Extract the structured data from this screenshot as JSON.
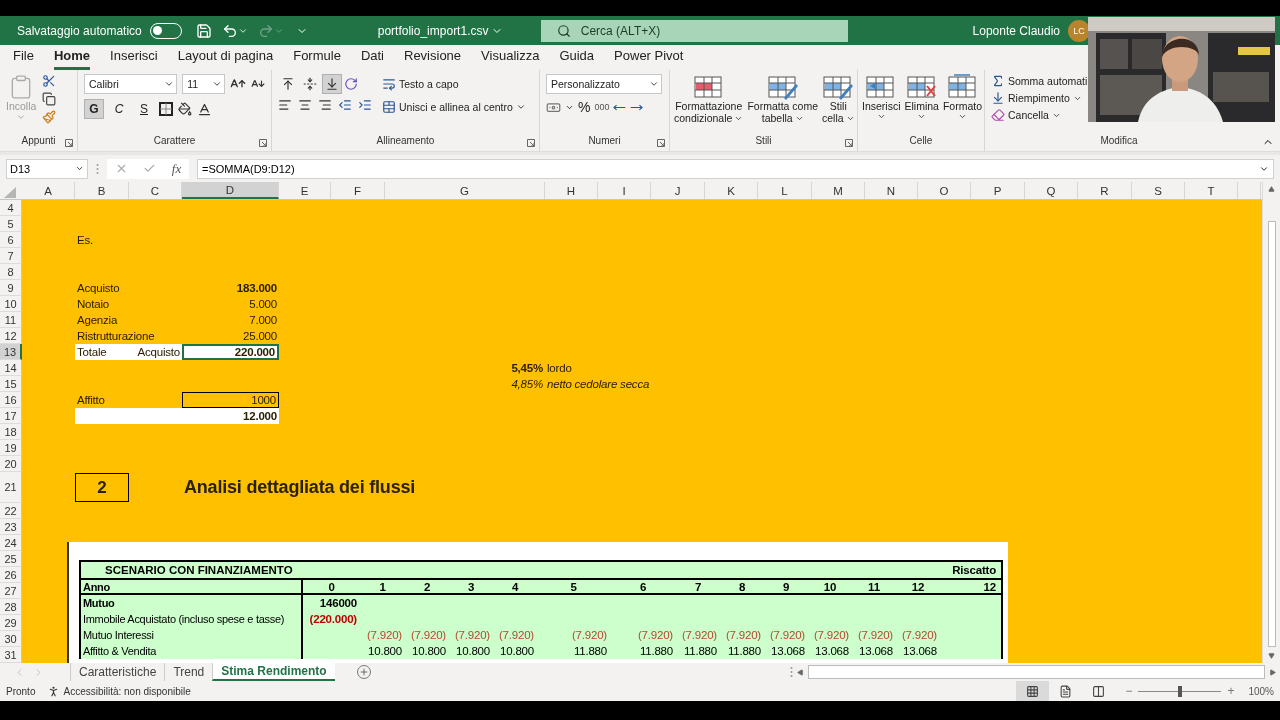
{
  "title_bar": {
    "autosave_label": "Salvataggio automatico",
    "autosave_on": false,
    "file_name": "portfolio_import1.csv",
    "search_placeholder": "Cerca (ALT+X)",
    "user_name": "Loponte Claudio",
    "user_initials": "LC"
  },
  "menu_tabs": [
    {
      "label": "File",
      "selected": false
    },
    {
      "label": "Home",
      "selected": true
    },
    {
      "label": "Inserisci",
      "selected": false
    },
    {
      "label": "Layout di pagina",
      "selected": false
    },
    {
      "label": "Formule",
      "selected": false
    },
    {
      "label": "Dati",
      "selected": false
    },
    {
      "label": "Revisione",
      "selected": false
    },
    {
      "label": "Visualizza",
      "selected": false
    },
    {
      "label": "Guida",
      "selected": false
    },
    {
      "label": "Power Pivot",
      "selected": false
    }
  ],
  "ribbon": {
    "appunti": {
      "paste": "Incolla",
      "group": "Appunti"
    },
    "carattere": {
      "font": "Calibri",
      "size": "11",
      "group": "Carattere",
      "toggles": [
        {
          "label": "G",
          "kind": "bold",
          "on": true
        },
        {
          "label": "C",
          "kind": "italic",
          "on": false
        },
        {
          "label": "S",
          "kind": "underline",
          "on": false
        }
      ]
    },
    "allineamento": {
      "vertical": [
        {
          "kind": "top",
          "on": false
        },
        {
          "kind": "middle",
          "on": false
        },
        {
          "kind": "bottom",
          "on": true
        }
      ],
      "wrap": "Testo a capo",
      "merge": "Unisci e allinea al centro",
      "group": "Allineamento"
    },
    "numeri": {
      "format": "Personalizzato",
      "percent": "%",
      "thousands": "000",
      "group": "Numeri"
    },
    "stili": {
      "buttons": [
        {
          "lines": [
            "Formattazione",
            "condizionale"
          ]
        },
        {
          "lines": [
            "Formatta come",
            "tabella"
          ]
        },
        {
          "lines": [
            "Stili",
            "cella"
          ]
        }
      ],
      "group": "Stili"
    },
    "celle": {
      "buttons": [
        "Inserisci",
        "Elimina",
        "Formato"
      ],
      "group": "Celle"
    },
    "modifica": {
      "items": [
        "Somma automati",
        "Riempimento",
        "Cancella"
      ],
      "group": "Modifica"
    }
  },
  "formula_bar": {
    "name_box": "D13",
    "fx": "fx",
    "formula": "=SOMMA(D9:D12)"
  },
  "columns": [
    {
      "label": "A",
      "selected": false
    },
    {
      "label": "B",
      "selected": false
    },
    {
      "label": "C",
      "selected": false
    },
    {
      "label": "D",
      "selected": true
    },
    {
      "label": "E",
      "selected": false
    },
    {
      "label": "F",
      "selected": false
    },
    {
      "label": "G",
      "selected": false
    },
    {
      "label": "H",
      "selected": false
    },
    {
      "label": "I",
      "selected": false
    },
    {
      "label": "J",
      "selected": false
    },
    {
      "label": "K",
      "selected": false
    },
    {
      "label": "L",
      "selected": false
    },
    {
      "label": "M",
      "selected": false
    },
    {
      "label": "N",
      "selected": false
    },
    {
      "label": "O",
      "selected": false
    },
    {
      "label": "P",
      "selected": false
    },
    {
      "label": "Q",
      "selected": false
    },
    {
      "label": "R",
      "selected": false
    },
    {
      "label": "S",
      "selected": false
    },
    {
      "label": "T",
      "selected": false
    }
  ],
  "rows": [
    {
      "number": "4",
      "selected": false
    },
    {
      "number": "5",
      "selected": false
    },
    {
      "number": "6",
      "selected": false,
      "cells": [
        {
          "kind": "note",
          "text": "Es."
        }
      ]
    },
    {
      "number": "7",
      "selected": false
    },
    {
      "number": "8",
      "selected": false
    },
    {
      "number": "9",
      "selected": false,
      "cells": [
        {
          "kind": "label",
          "text": "Acquisto"
        },
        {
          "kind": "amount-strong",
          "text": "183.000"
        }
      ]
    },
    {
      "number": "10",
      "selected": false,
      "cells": [
        {
          "kind": "label",
          "text": "Notaio"
        },
        {
          "kind": "amount",
          "text": "5.000"
        }
      ]
    },
    {
      "number": "11",
      "selected": false,
      "cells": [
        {
          "kind": "label",
          "text": "Agenzia"
        },
        {
          "kind": "amount",
          "text": "7.000"
        }
      ]
    },
    {
      "number": "12",
      "selected": false,
      "cells": [
        {
          "kind": "label",
          "text": "Ristrutturazione"
        },
        {
          "kind": "amount",
          "text": "25.000"
        }
      ]
    },
    {
      "number": "13",
      "selected": true,
      "cells": [
        {
          "kind": "total-label",
          "text": "Totale"
        },
        {
          "kind": "total-sub",
          "text": "Acquisto"
        },
        {
          "kind": "total-amount",
          "text": "220.000"
        }
      ]
    },
    {
      "number": "14",
      "selected": false,
      "cells": [
        {
          "kind": "rate-strong",
          "text": "5,45%"
        },
        {
          "kind": "rate-note",
          "text": "lordo"
        }
      ]
    },
    {
      "number": "15",
      "selected": false,
      "cells": [
        {
          "kind": "rate-italic",
          "text": "4,85%"
        },
        {
          "kind": "rate-note-italic",
          "text": "netto cedolare secca"
        }
      ]
    },
    {
      "number": "16",
      "selected": false,
      "cells": [
        {
          "kind": "label",
          "text": "Affitto"
        },
        {
          "kind": "input-amount",
          "text": "1000"
        }
      ]
    },
    {
      "number": "17",
      "selected": false,
      "cells": [
        {
          "kind": "blank-white"
        },
        {
          "kind": "total-amount",
          "text": "12.000"
        }
      ]
    },
    {
      "number": "18",
      "selected": false
    },
    {
      "number": "19",
      "selected": false
    },
    {
      "number": "20",
      "selected": false
    },
    {
      "number": "21",
      "selected": false,
      "cells": [
        {
          "kind": "section-number",
          "text": "2"
        },
        {
          "kind": "section-title",
          "text": "Analisi dettagliata dei flussi"
        }
      ]
    },
    {
      "number": "22",
      "selected": false
    },
    {
      "number": "23",
      "selected": false
    },
    {
      "number": "24",
      "selected": false
    },
    {
      "number": "25",
      "selected": false
    },
    {
      "number": "26",
      "selected": false
    },
    {
      "number": "27",
      "selected": false
    },
    {
      "number": "28",
      "selected": false
    },
    {
      "number": "29",
      "selected": false
    },
    {
      "number": "30",
      "selected": false
    },
    {
      "number": "31",
      "selected": false
    }
  ],
  "scenario_table": [
    {
      "kind": "title",
      "label": "SCENARIO CON FINANZIAMENTO",
      "right_label": "Riscatto"
    },
    {
      "kind": "header",
      "label": "Anno",
      "values": [
        "0",
        "1",
        "2",
        "3",
        "4",
        "5",
        "6",
        "7",
        "8",
        "9",
        "10",
        "11",
        "12",
        "12"
      ]
    },
    {
      "kind": "bold",
      "label": "Mutuo",
      "values": [
        "146000"
      ]
    },
    {
      "kind": "cost",
      "label": "Immobile Acquistato (incluso spese e tasse)",
      "values": [
        "(220.000)"
      ]
    },
    {
      "kind": "negative",
      "label": "Mutuo Interessi",
      "starts_at_year_1": true,
      "values": [
        "(7.920)",
        "(7.920)",
        "(7.920)",
        "(7.920)",
        "(7.920)",
        "(7.920)",
        "(7.920)",
        "(7.920)",
        "(7.920)",
        "(7.920)",
        "(7.920)",
        "(7.920)"
      ]
    },
    {
      "kind": "normal",
      "label": "Affitto & Vendita",
      "starts_at_year_1": true,
      "values": [
        "10.800",
        "10.800",
        "10.800",
        "10.800",
        "11.880",
        "11.880",
        "11.880",
        "11.880",
        "13.068",
        "13.068",
        "13.068",
        "13.068"
      ]
    }
  ],
  "sheet_tabs": [
    {
      "label": "Caratteristiche",
      "selected": false
    },
    {
      "label": "Trend",
      "selected": false
    },
    {
      "label": "Stima Rendimento",
      "selected": true
    }
  ],
  "status_bar": {
    "ready": "Pronto",
    "accessibility": "Accessibilità: non disponibile",
    "views": [
      {
        "kind": "normal",
        "selected": true
      },
      {
        "kind": "page-layout",
        "selected": false
      },
      {
        "kind": "page-break",
        "selected": false
      }
    ],
    "zoom_out": "−",
    "zoom_in": "+",
    "zoom_slider": {
      "level": 0.5
    },
    "zoom": "100%"
  }
}
